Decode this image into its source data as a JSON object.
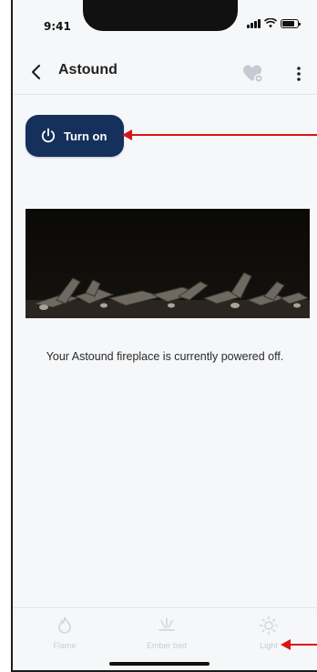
{
  "status_bar": {
    "time": "9:41"
  },
  "header": {
    "title": "Astound",
    "back_icon": "chevron-left-icon",
    "favorite_icon": "heart-settings-icon",
    "more_icon": "vertical-dots-icon"
  },
  "power": {
    "label": "Turn on",
    "icon": "power-icon",
    "color": "#14305b"
  },
  "fireplace_image": {
    "icon": "fireplace-logs-image"
  },
  "status_message": "Your Astound fireplace is currently powered off.",
  "tabs": [
    {
      "label": "Flame",
      "icon": "flame-icon"
    },
    {
      "label": "Ember bed",
      "icon": "ember-bed-icon"
    },
    {
      "label": "Light",
      "icon": "sun-icon"
    }
  ],
  "annotation_color": "#d9141b"
}
